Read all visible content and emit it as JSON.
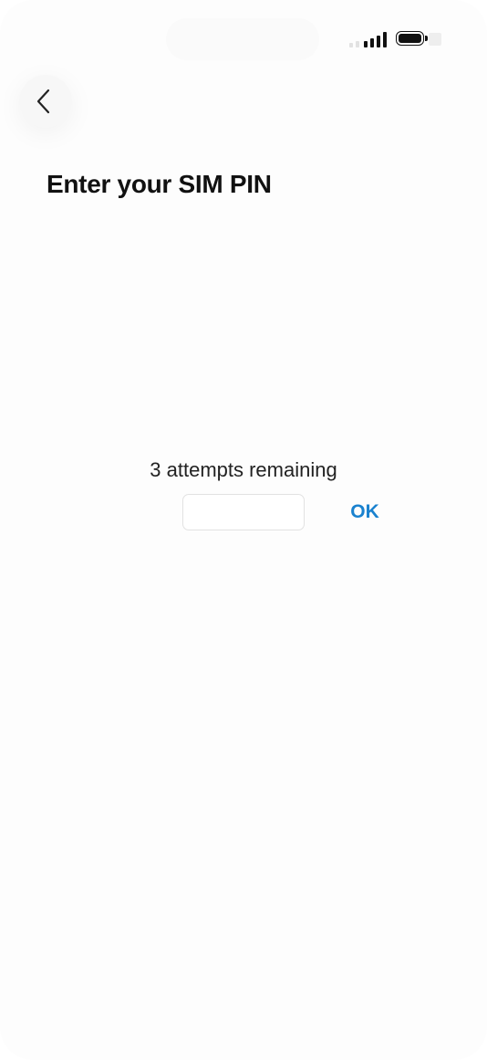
{
  "status_bar": {
    "signal_icon": "cellular-signal-icon",
    "battery_icon": "battery-icon",
    "battery_level": 1.0
  },
  "header": {
    "back_icon": "chevron-left-icon",
    "title": "Enter your SIM PIN"
  },
  "pin_form": {
    "attempts_text": "3 attempts remaining",
    "pin_value": "",
    "pin_placeholder": "",
    "ok_label": "OK",
    "ok_color": "#1a82cf"
  }
}
